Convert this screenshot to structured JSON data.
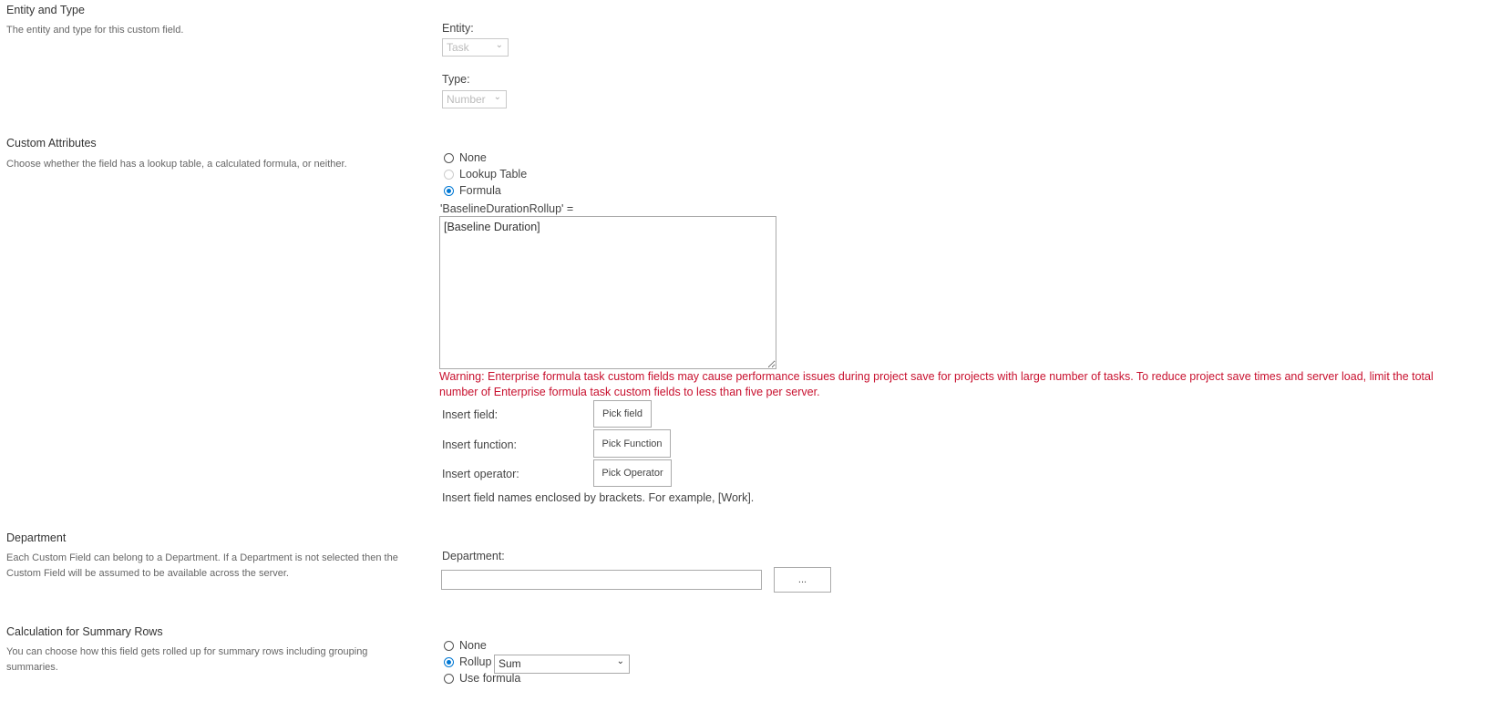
{
  "entity_type": {
    "title": "Entity and Type",
    "description": "The entity and type for this custom field.",
    "entity_label": "Entity:",
    "entity_value": "Task",
    "type_label": "Type:",
    "type_value": "Number"
  },
  "custom_attributes": {
    "title": "Custom Attributes",
    "description": "Choose whether the field has a lookup table, a calculated formula, or neither.",
    "options": [
      "None",
      "Lookup Table",
      "Formula"
    ],
    "formula_label": "'BaselineDurationRollup' =",
    "formula_value": "[Baseline Duration]",
    "warning_line1": "Warning: Enterprise formula task custom fields may cause performance issues during project save for projects with large number of tasks. To reduce project save times and server load, limit the total",
    "warning_line2": "number of Enterprise formula task custom fields to less than five per server.",
    "insert_field_label": "Insert field:",
    "insert_function_label": "Insert function:",
    "insert_operator_label": "Insert operator:",
    "pick_field": "Pick field",
    "pick_function": "Pick Function",
    "pick_operator": "Pick Operator",
    "hint": "Insert field names enclosed by brackets. For example, [Work]."
  },
  "department": {
    "title": "Department",
    "description": "Each Custom Field can belong to a Department. If a Department is not selected then the Custom Field will be assumed to be available across the server.",
    "label": "Department:",
    "value": "",
    "browse": "..."
  },
  "summary": {
    "title": "Calculation for Summary Rows",
    "description": "You can choose how this field gets rolled up for summary rows including grouping summaries.",
    "options": [
      "None",
      "Rollup",
      "Use formula"
    ],
    "rollup_value": "Sum"
  }
}
